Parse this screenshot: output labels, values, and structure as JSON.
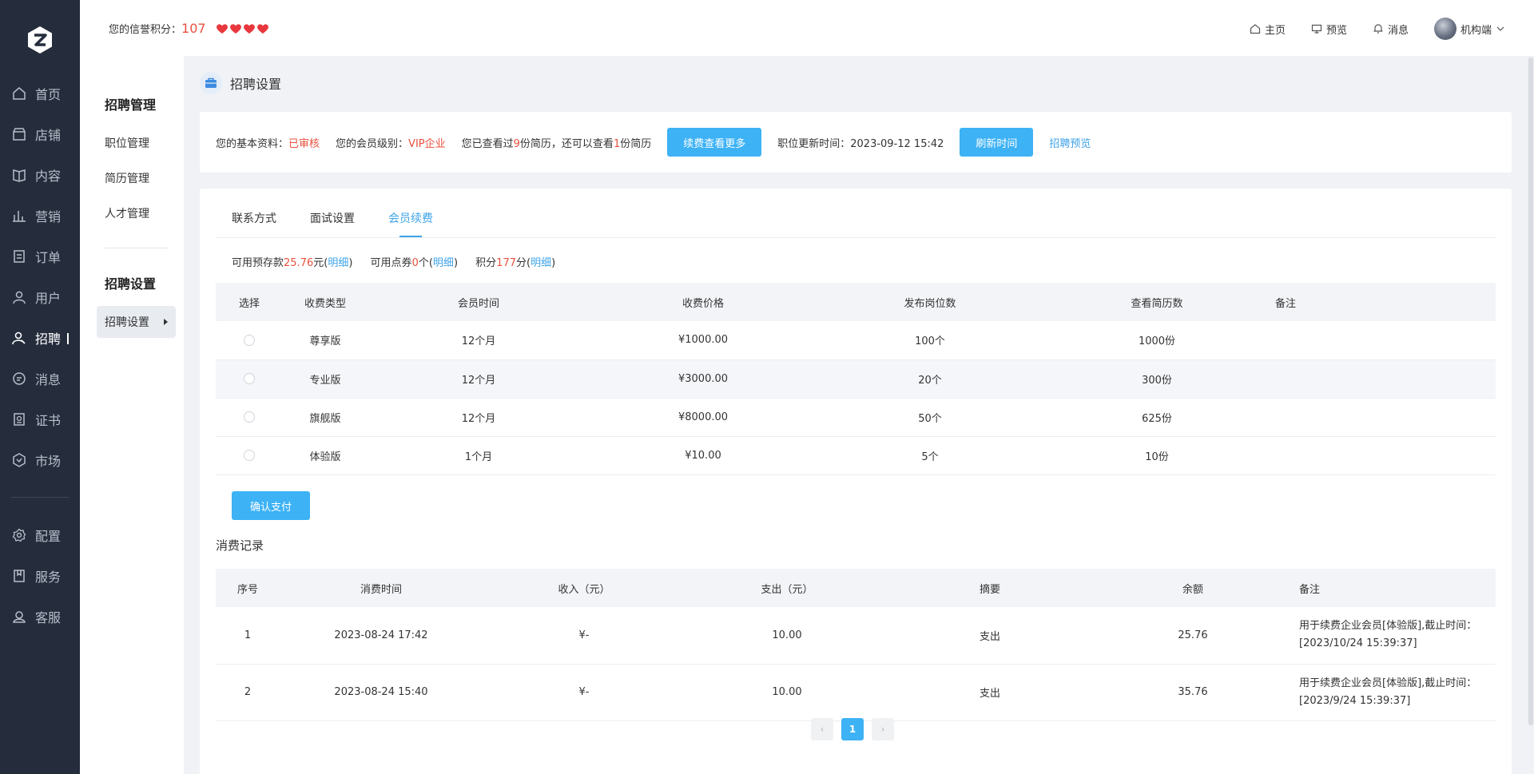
{
  "sidebar": {
    "items": [
      {
        "label": "首页",
        "icon": "home-icon"
      },
      {
        "label": "店铺",
        "icon": "store-icon"
      },
      {
        "label": "内容",
        "icon": "book-icon"
      },
      {
        "label": "营销",
        "icon": "bar-chart-icon"
      },
      {
        "label": "订单",
        "icon": "order-icon"
      },
      {
        "label": "用户",
        "icon": "user-icon"
      },
      {
        "label": "招聘",
        "icon": "recruit-icon",
        "active": true
      },
      {
        "label": "消息",
        "icon": "message-icon"
      },
      {
        "label": "证书",
        "icon": "certificate-icon"
      },
      {
        "label": "市场",
        "icon": "market-icon"
      }
    ],
    "bottom_items": [
      {
        "label": "配置",
        "icon": "settings-icon"
      },
      {
        "label": "服务",
        "icon": "service-icon"
      },
      {
        "label": "客服",
        "icon": "support-icon"
      }
    ]
  },
  "topbar": {
    "credit_label": "您的信誉积分：",
    "credit_value": "107",
    "home": "主页",
    "preview": "预览",
    "messages": "消息",
    "user": "机构端"
  },
  "subsidebar": {
    "group1": "招聘管理",
    "links": [
      "职位管理",
      "简历管理",
      "人才管理"
    ],
    "group2": "招聘设置",
    "selected": "招聘设置"
  },
  "page": {
    "title": "招聘设置"
  },
  "infobar": {
    "basic_label": "您的基本资料：",
    "basic_status": "已审核",
    "level_label": "您的会员级别：",
    "level_value": "VIP企业",
    "viewed_prefix": "您已查看过",
    "viewed_count": "9",
    "viewed_mid": "份简历，还可以查看",
    "remain_count": "1",
    "viewed_suffix": "份简历",
    "renew_button": "续费查看更多",
    "update_label": "职位更新时间：2023-09-12 15:42",
    "refresh_button": "刷新时间",
    "preview_link": "招聘预览"
  },
  "tabs": [
    "联系方式",
    "面试设置",
    "会员续费"
  ],
  "balance": {
    "deposit_label": "可用预存款",
    "deposit_value": "25.76",
    "deposit_unit": "元(",
    "coupon_label": "可用点券",
    "coupon_value": "0",
    "coupon_unit": "个(",
    "points_label": "积分",
    "points_value": "177",
    "points_unit": "分(",
    "detail": "明细",
    "close": ")"
  },
  "plans": {
    "headers": [
      "选择",
      "收费类型",
      "会员时间",
      "收费价格",
      "发布岗位数",
      "查看简历数",
      "备注"
    ],
    "rows": [
      {
        "type": "尊享版",
        "period": "12个月",
        "price": "¥1000.00",
        "posts": "100个",
        "resumes": "1000份",
        "note": ""
      },
      {
        "type": "专业版",
        "period": "12个月",
        "price": "¥3000.00",
        "posts": "20个",
        "resumes": "300份",
        "note": ""
      },
      {
        "type": "旗舰版",
        "period": "12个月",
        "price": "¥8000.00",
        "posts": "50个",
        "resumes": "625份",
        "note": ""
      },
      {
        "type": "体验版",
        "period": "1个月",
        "price": "¥10.00",
        "posts": "5个",
        "resumes": "10份",
        "note": ""
      }
    ]
  },
  "pay_button": "确认支付",
  "records": {
    "title": "消费记录",
    "headers": [
      "序号",
      "消费时间",
      "收入（元）",
      "支出（元）",
      "摘要",
      "余额",
      "备注"
    ],
    "rows": [
      {
        "no": "1",
        "time": "2023-08-24 17:42",
        "income": "¥-",
        "expense": "10.00",
        "summary": "支出",
        "balance": "25.76",
        "note": "用于续费企业会员[体验版],截止时间：[2023/10/24 15:39:37]"
      },
      {
        "no": "2",
        "time": "2023-08-24 15:40",
        "income": "¥-",
        "expense": "10.00",
        "summary": "支出",
        "balance": "35.76",
        "note": "用于续费企业会员[体验版],截止时间：[2023/9/24 15:39:37]"
      }
    ]
  },
  "pagination": {
    "current": "1",
    "prev": "‹",
    "next": "›"
  },
  "colors": {
    "accent": "#3db2f5",
    "link": "#3da3e8",
    "highlight": "#e9503e",
    "sidebar": "#252d3d"
  }
}
